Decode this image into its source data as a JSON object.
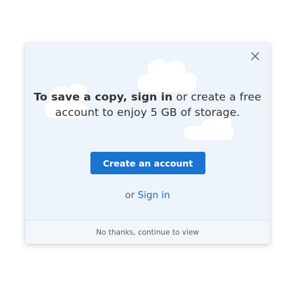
{
  "dialog": {
    "message_bold": "To save a copy, sign in",
    "message_rest_line1": " or create a free",
    "message_line2": "account to enjoy 5 GB of storage.",
    "create_account_label": "Create an account",
    "or_text": "or ",
    "sign_in_label": "Sign in",
    "no_thanks_label": "No thanks, continue to view",
    "close_icon": "close-icon"
  },
  "colors": {
    "dialog_background": "#eef4fb",
    "primary_button": "#1a73d0",
    "link": "#0f6cbd",
    "cloud": "#ffffff"
  }
}
